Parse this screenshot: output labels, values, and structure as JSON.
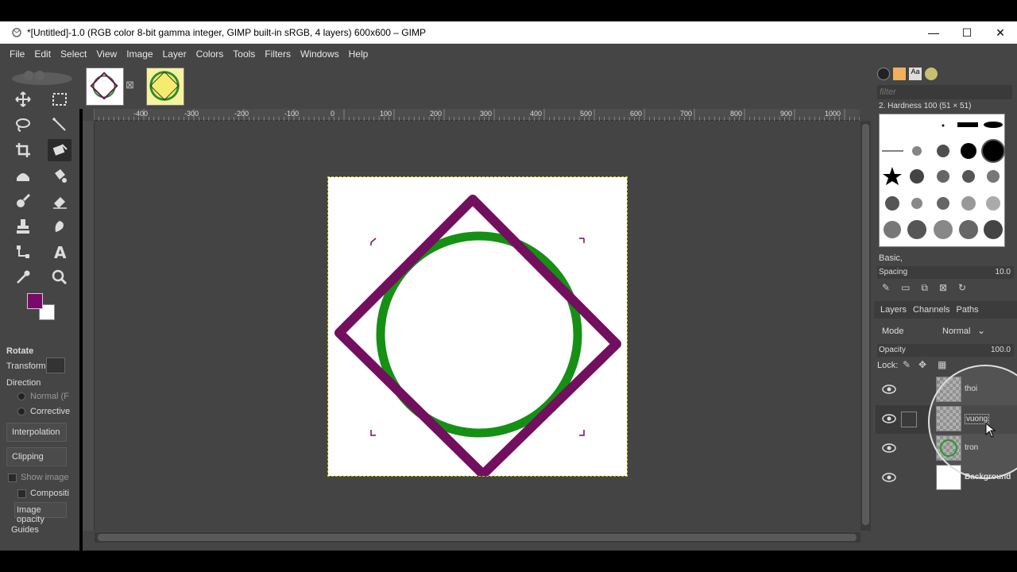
{
  "window": {
    "title": "*[Untitled]-1.0 (RGB color 8-bit gamma integer, GIMP built-in sRGB, 4 layers) 600x600 – GIMP",
    "minimize": "—",
    "maximize": "☐",
    "close": "✕"
  },
  "menu": [
    "File",
    "Edit",
    "Select",
    "View",
    "Image",
    "Layer",
    "Colors",
    "Tools",
    "Filters",
    "Windows",
    "Help"
  ],
  "colors": {
    "foreground": "#7a0a6a",
    "background": "#ffffff",
    "circle": "#159015",
    "square": "#720f5e"
  },
  "tool_options": {
    "title": "Rotate",
    "transform_label": "Transform:",
    "direction_label": "Direction",
    "direction_normal": "Normal (F",
    "direction_corrective": "Corrective",
    "interpolation": "Interpolation",
    "clipping": "Clipping",
    "show_image": "Show image",
    "composite": "Compositi",
    "image_opacity": "Image opacity",
    "guides": "Guides"
  },
  "ruler_labels": [
    "-400",
    "-300",
    "-200",
    "-100",
    "0",
    "100",
    "200",
    "300",
    "400",
    "500",
    "600",
    "700",
    "800",
    "900",
    "1000"
  ],
  "brushes": {
    "filter_placeholder": "filter",
    "title": "2. Hardness 100 (51 × 51)",
    "tag": "Basic,",
    "spacing_label": "Spacing",
    "spacing_value": "10.0"
  },
  "layers_panel": {
    "tabs": [
      "Layers",
      "Channels",
      "Paths"
    ],
    "mode_label": "Mode",
    "mode_value": "Normal",
    "opacity_label": "Opacity",
    "opacity_value": "100.0",
    "lock_label": "Lock:",
    "layers": [
      {
        "name": "thoi"
      },
      {
        "name": "vuong"
      },
      {
        "name": "tron"
      },
      {
        "name": "Background"
      }
    ]
  }
}
